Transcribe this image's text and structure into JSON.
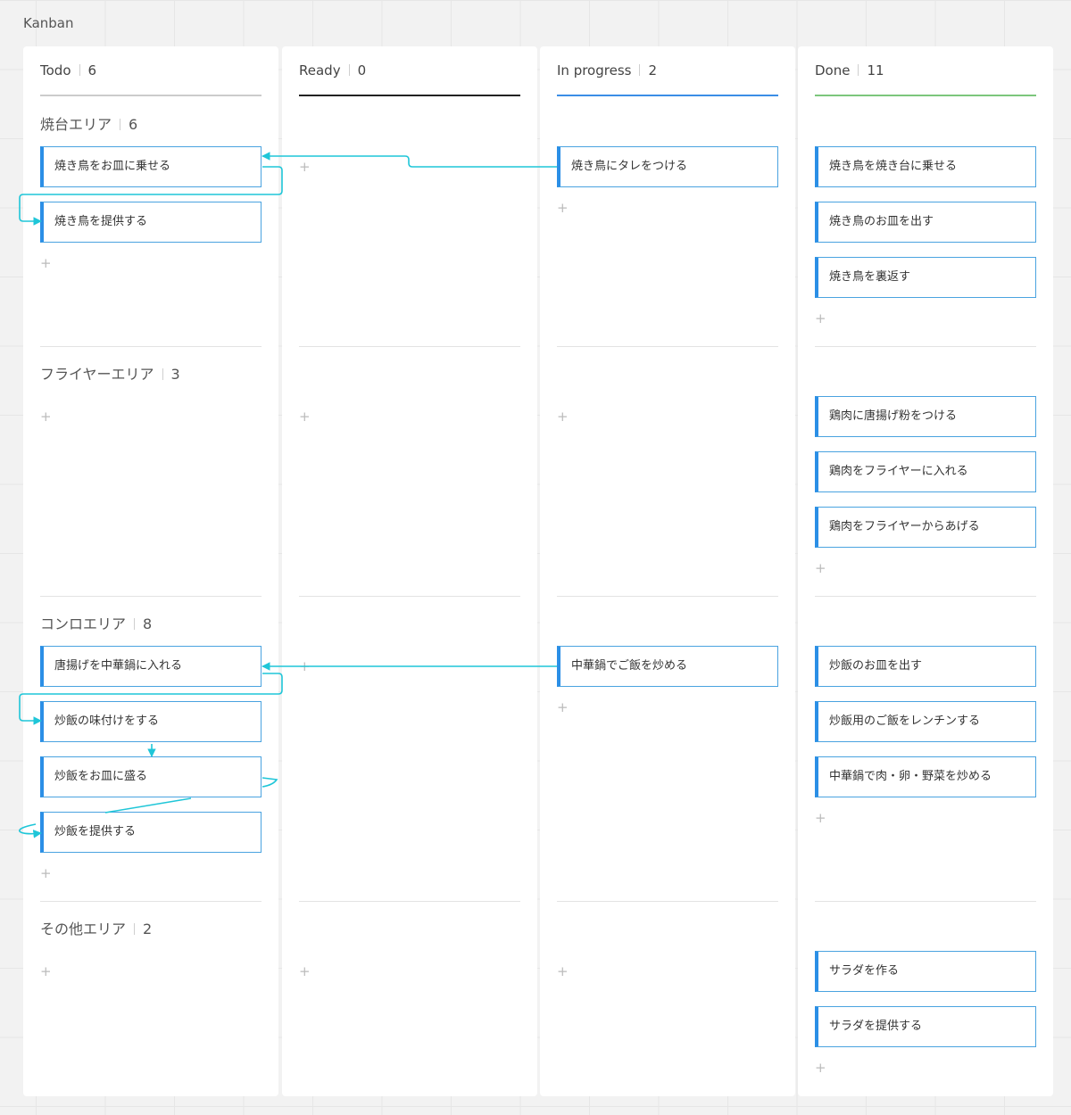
{
  "frame_title": "Kanban",
  "colors": {
    "accent": "#2b8fe6",
    "connector": "#1fc6d8",
    "todo_underline": "#cccccc",
    "ready_underline": "#222222",
    "progress_underline": "#3a8ee6",
    "done_underline": "#7cc67c"
  },
  "columns": [
    {
      "name": "Todo",
      "count": "6"
    },
    {
      "name": "Ready",
      "count": "0"
    },
    {
      "name": "In progress",
      "count": "2"
    },
    {
      "name": "Done",
      "count": "11"
    }
  ],
  "lanes": [
    {
      "name": "焼台エリア",
      "count": "6"
    },
    {
      "name": "フライヤーエリア",
      "count": "3"
    },
    {
      "name": "コンロエリア",
      "count": "8"
    },
    {
      "name": "その他エリア",
      "count": "2"
    }
  ],
  "cards": {
    "todo": [
      [
        "焼き鳥をお皿に乗せる",
        "焼き鳥を提供する"
      ],
      [],
      [
        "唐揚げを中華鍋に入れる",
        "炒飯の味付けをする",
        "炒飯をお皿に盛る",
        "炒飯を提供する"
      ],
      []
    ],
    "ready": [
      [],
      [],
      [],
      []
    ],
    "progress": [
      [
        "焼き鳥にタレをつける"
      ],
      [],
      [
        "中華鍋でご飯を炒める"
      ],
      []
    ],
    "done": [
      [
        "焼き鳥を焼き台に乗せる",
        "焼き鳥のお皿を出す",
        "焼き鳥を裏返す"
      ],
      [
        "鶏肉に唐揚げ粉をつける",
        "鶏肉をフライヤーに入れる",
        "鶏肉をフライヤーからあげる"
      ],
      [
        "炒飯のお皿を出す",
        "炒飯用のご飯をレンチンする",
        "中華鍋で肉・卵・野菜を炒める"
      ],
      [
        "サラダを作る",
        "サラダを提供する"
      ]
    ]
  },
  "add_symbol": "+"
}
